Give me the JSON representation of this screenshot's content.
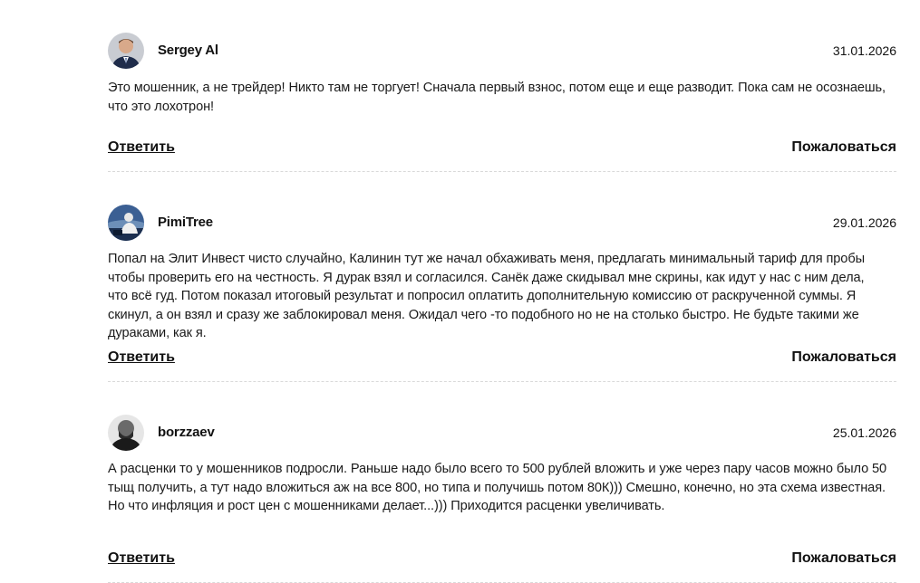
{
  "comments": [
    {
      "author": "Sergey Al",
      "date": "31.01.2026",
      "text": "Это мошенник, а не трейдер! Никто там не торгует! Сначала первый взнос, потом еще и еще разводит. Пока сам не осознаешь, что это лохотрон!",
      "reply_label": "Ответить",
      "report_label": "Пожаловаться"
    },
    {
      "author": "PimiTree",
      "date": "29.01.2026",
      "text": "Попал на Элит Инвест чисто случайно, Калинин тут же начал обхаживать меня, предлагать минимальный тариф для пробы чтобы проверить его на честность. Я дурак взял и согласился. Санёк даже скидывал мне скрины, как идут у нас с ним дела, что всё гуд. Потом показал итоговый результат и попросил оплатить дополнительную комиссию от раскрученной суммы. Я скинул, а он взял и сразу же заблокировал меня. Ожидал чего -то подобного но не на столько быстро. Не будьте такими же дураками, как я.",
      "reply_label": "Ответить",
      "report_label": "Пожаловаться"
    },
    {
      "author": "borzzaev",
      "date": "25.01.2026",
      "text": "А расценки то у мошенников подросли. Раньше надо было всего то 500 рублей вложить и уже через пару часов можно было 50 тыщ получить, а тут надо вложиться аж на все 800, но типа и получишь потом 80К))) Смешно, конечно, но эта схема известная. Но что инфляция и рост цен с мошенниками делает...))) Приходится расценки увеличивать.",
      "reply_label": "Ответить",
      "report_label": "Пожаловаться"
    }
  ]
}
